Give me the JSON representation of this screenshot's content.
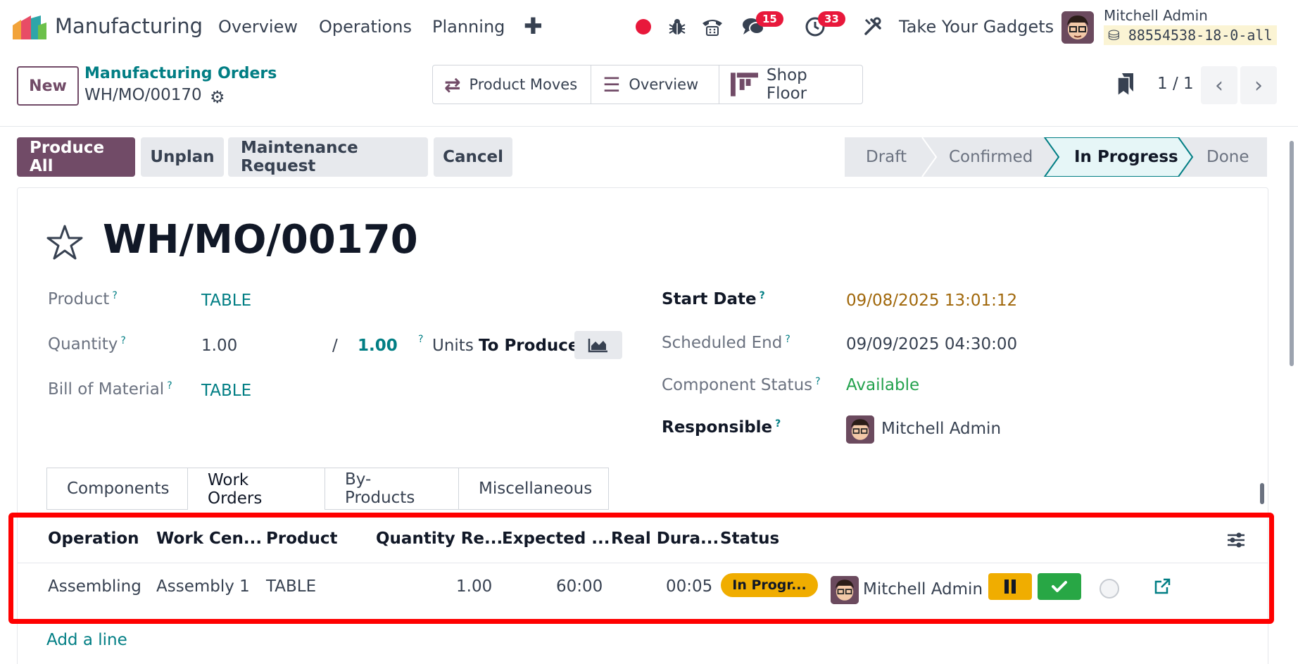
{
  "navbar": {
    "app_name": "Manufacturing",
    "menu": [
      "Overview",
      "Operations",
      "Planning"
    ],
    "add_icon": "plus-icon",
    "discuss_count": "15",
    "activity_count": "33",
    "company": "Take Your Gadgets",
    "user_name": "Mitchell Admin",
    "database": "88554538-18-0-all",
    "recording_color": "#e8183b"
  },
  "control": {
    "new_label": "New",
    "breadcrumb_parent": "Manufacturing Orders",
    "breadcrumb_current": "WH/MO/00170",
    "smart_buttons": [
      "Product Moves",
      "Overview",
      "Shop Floor"
    ],
    "pager": "1 / 1"
  },
  "actions": {
    "produce_all": "Produce All",
    "unplan": "Unplan",
    "maintenance": "Maintenance Request",
    "cancel": "Cancel"
  },
  "status_steps": {
    "draft": "Draft",
    "confirmed": "Confirmed",
    "in_progress": "In Progress",
    "done": "Done",
    "current": "In Progress"
  },
  "form": {
    "title": "WH/MO/00170",
    "product_label": "Product",
    "product_value": "TABLE",
    "quantity_label": "Quantity",
    "quantity_value": "1.00",
    "quantity_sep": "/",
    "quantity_target": "1.00",
    "units_label": "Units",
    "to_produce_label": "To Produce",
    "bom_label": "Bill of Material",
    "bom_value": "TABLE",
    "start_date_label": "Start Date",
    "start_date_value": "09/08/2025 13:01:12",
    "scheduled_end_label": "Scheduled End",
    "scheduled_end_value": "09/09/2025 04:30:00",
    "component_status_label": "Component Status",
    "component_status_value": "Available",
    "responsible_label": "Responsible",
    "responsible_value": "Mitchell Admin",
    "help_mark": "?"
  },
  "tabs": [
    "Components",
    "Work Orders",
    "By-Products",
    "Miscellaneous"
  ],
  "active_tab": "Work Orders",
  "work_orders": {
    "columns": [
      "Operation",
      "Work Cen...",
      "Product",
      "Quantity Re...",
      "Expected ...",
      "Real Dura...",
      "Status"
    ],
    "rows": [
      {
        "operation": "Assembling",
        "work_center": "Assembly 1",
        "product": "TABLE",
        "quantity": "1.00",
        "expected": "60:00",
        "real_duration": "00:05",
        "status": "In Progr...",
        "user": "Mitchell Admin"
      }
    ],
    "add_line": "Add a line"
  },
  "colors": {
    "brand": "#714b67",
    "link": "#017e84",
    "highlight": "#ff0000",
    "status_pill": "#f0ad00",
    "done_button": "#28a745"
  }
}
